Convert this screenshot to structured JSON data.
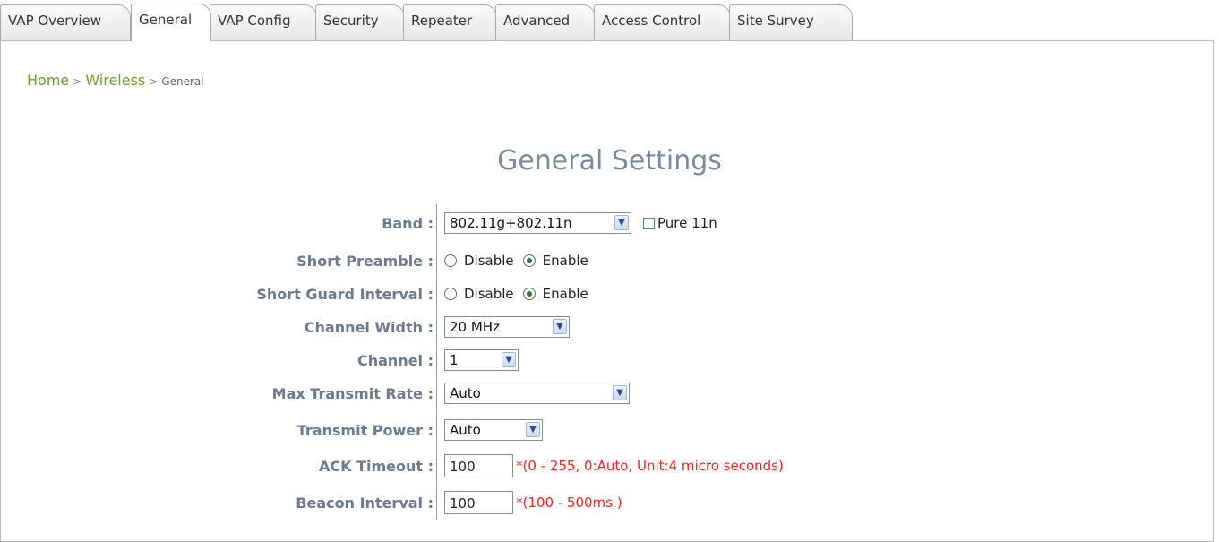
{
  "tabs": [
    "VAP Overview",
    "General",
    "VAP Config",
    "Security",
    "Repeater",
    "Advanced",
    "Access Control",
    "Site Survey"
  ],
  "active_tab": "General",
  "breadcrumb": {
    "home": "Home",
    "sep1": ">",
    "wireless": "Wireless",
    "sep2": ">",
    "current": "General"
  },
  "title": "General Settings",
  "form": {
    "band": {
      "label": "Band :",
      "value": "802.11g+802.11n",
      "pure11n_label": "Pure 11n"
    },
    "short_preamble": {
      "label": "Short Preamble :",
      "disable": "Disable",
      "enable": "Enable",
      "selected": "Enable"
    },
    "short_guard": {
      "label": "Short Guard Interval :",
      "disable": "Disable",
      "enable": "Enable",
      "selected": "Enable"
    },
    "channel_width": {
      "label": "Channel Width :",
      "value": "20 MHz"
    },
    "channel": {
      "label": "Channel :",
      "value": "1"
    },
    "max_rate": {
      "label": "Max Transmit Rate :",
      "value": "Auto"
    },
    "tx_power": {
      "label": "Transmit Power :",
      "value": "Auto"
    },
    "ack_timeout": {
      "label": "ACK Timeout :",
      "value": "100",
      "hint": "*(0 - 255, 0:Auto, Unit:4 micro seconds)"
    },
    "beacon": {
      "label": "Beacon Interval :",
      "value": "100",
      "hint": "*(100 - 500ms )"
    }
  }
}
